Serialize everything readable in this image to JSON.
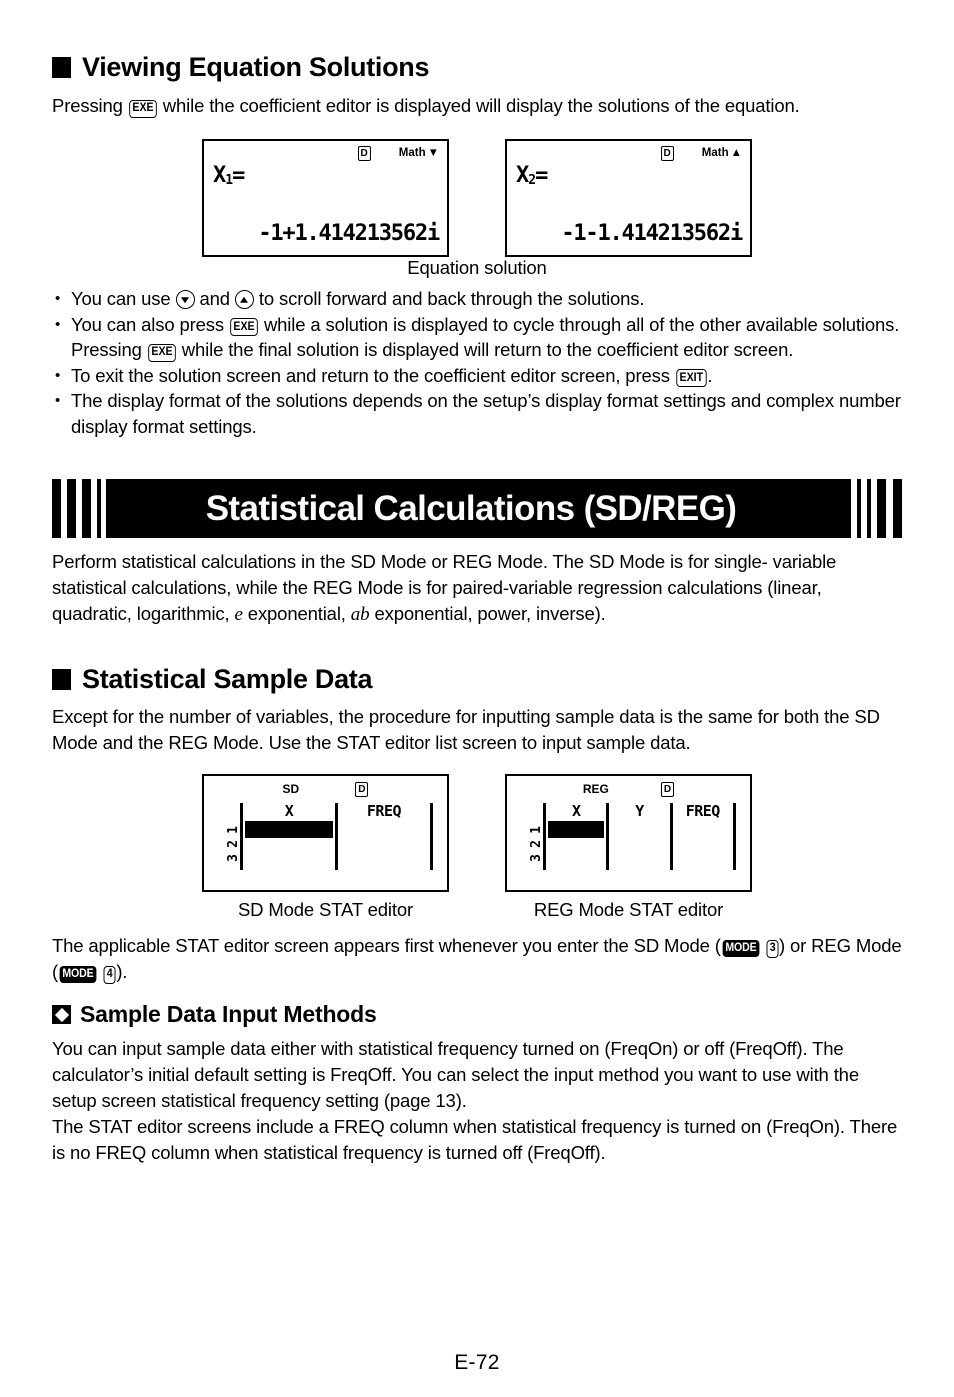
{
  "section1": {
    "heading": "Viewing Equation Solutions",
    "intro_before": "Pressing",
    "intro_key": "EXE",
    "intro_after": "while the coefficient editor is displayed will display the solutions of the equation.",
    "screens": [
      {
        "status_mode": "D",
        "status_math": "Math",
        "status_arrow": "▼",
        "line1_var": "X",
        "line1_sub": "1",
        "line1_eq": "=",
        "line2": "-1+1.414213562i"
      },
      {
        "status_mode": "D",
        "status_math": "Math",
        "status_arrow": "▲",
        "line1_var": "X",
        "line1_sub": "2",
        "line1_eq": "=",
        "line2": "-1-1.414213562i"
      }
    ],
    "figure_caption": "Equation solution",
    "bullets": [
      {
        "parts": [
          {
            "t": "text",
            "v": "You can use "
          },
          {
            "t": "arrow-down",
            "v": "down-arrow-key"
          },
          {
            "t": "text",
            "v": " and "
          },
          {
            "t": "arrow-up",
            "v": "up-arrow-key"
          },
          {
            "t": "text",
            "v": " to scroll forward and back through the solutions."
          }
        ]
      },
      {
        "parts": [
          {
            "t": "text",
            "v": "You can also press "
          },
          {
            "t": "key",
            "v": "EXE"
          },
          {
            "t": "text",
            "v": " while a solution is displayed to cycle through all of the other available solutions. Pressing "
          },
          {
            "t": "key",
            "v": "EXE"
          },
          {
            "t": "text",
            "v": " while the final solution is displayed will return to the coefficient editor screen."
          }
        ]
      },
      {
        "parts": [
          {
            "t": "text",
            "v": "To exit the solution screen and return to the coefficient editor screen, press "
          },
          {
            "t": "key",
            "v": "EXIT"
          },
          {
            "t": "text",
            "v": "."
          }
        ]
      },
      {
        "parts": [
          {
            "t": "text",
            "v": "The display format of the solutions depends on the setup’s display format settings and complex number display format settings."
          }
        ]
      }
    ]
  },
  "banner": {
    "title": "Statistical Calculations (SD/REG)",
    "left_bars": [
      9,
      9,
      9,
      4,
      4
    ],
    "left_gaps": [
      6,
      6,
      6,
      5
    ],
    "right_bars": [
      19,
      4,
      4,
      9,
      9
    ],
    "intro_line1": "Perform statistical calculations in the SD Mode or REG Mode. The SD Mode is for single-",
    "intro_line2": "variable statistical calculations, while the REG Mode is for paired-variable regression",
    "intro_line3_a": "calculations (linear, quadratic, logarithmic, ",
    "intro_italic_e": "e",
    "intro_line3_b": " exponential, ",
    "intro_italic_ab": "ab",
    "intro_line3_c": " exponential, power, inverse)."
  },
  "section2": {
    "heading": "Statistical Sample Data",
    "intro": "Except for the number of variables, the procedure for inputting sample data is the same for both the SD Mode and the REG Mode. Use the STAT editor list screen to input sample data.",
    "stat_screens": [
      {
        "mode_label": "SD",
        "status_mode": "D",
        "row_numbers": [
          "1",
          "2",
          "3"
        ],
        "columns": [
          "X",
          "FREQ"
        ],
        "caption": "SD Mode STAT editor"
      },
      {
        "mode_label": "REG",
        "status_mode": "D",
        "row_numbers": [
          "1",
          "2",
          "3"
        ],
        "columns": [
          "X",
          "Y",
          "FREQ"
        ],
        "caption": "REG Mode STAT editor"
      }
    ],
    "after_a": "The applicable STAT editor screen appears first whenever you enter the SD Mode (",
    "after_key_mode1": "MODE",
    "after_key_num1": "3",
    "after_b": ") or REG Mode (",
    "after_key_mode2": "MODE",
    "after_key_num2": "4",
    "after_c": ")."
  },
  "section3": {
    "heading": "Sample Data Input Methods",
    "para1": "You can input sample data either with statistical frequency turned on (FreqOn) or off (FreqOff). The calculator’s initial default setting is FreqOff. You can select the input method you want to use with the setup screen statistical frequency setting (page 13).",
    "para2": "The STAT editor screens include a FREQ column when statistical frequency is turned on (FreqOn). There is no FREQ column when statistical frequency is turned off (FreqOff)."
  },
  "footer": {
    "page_number": "E-72"
  }
}
